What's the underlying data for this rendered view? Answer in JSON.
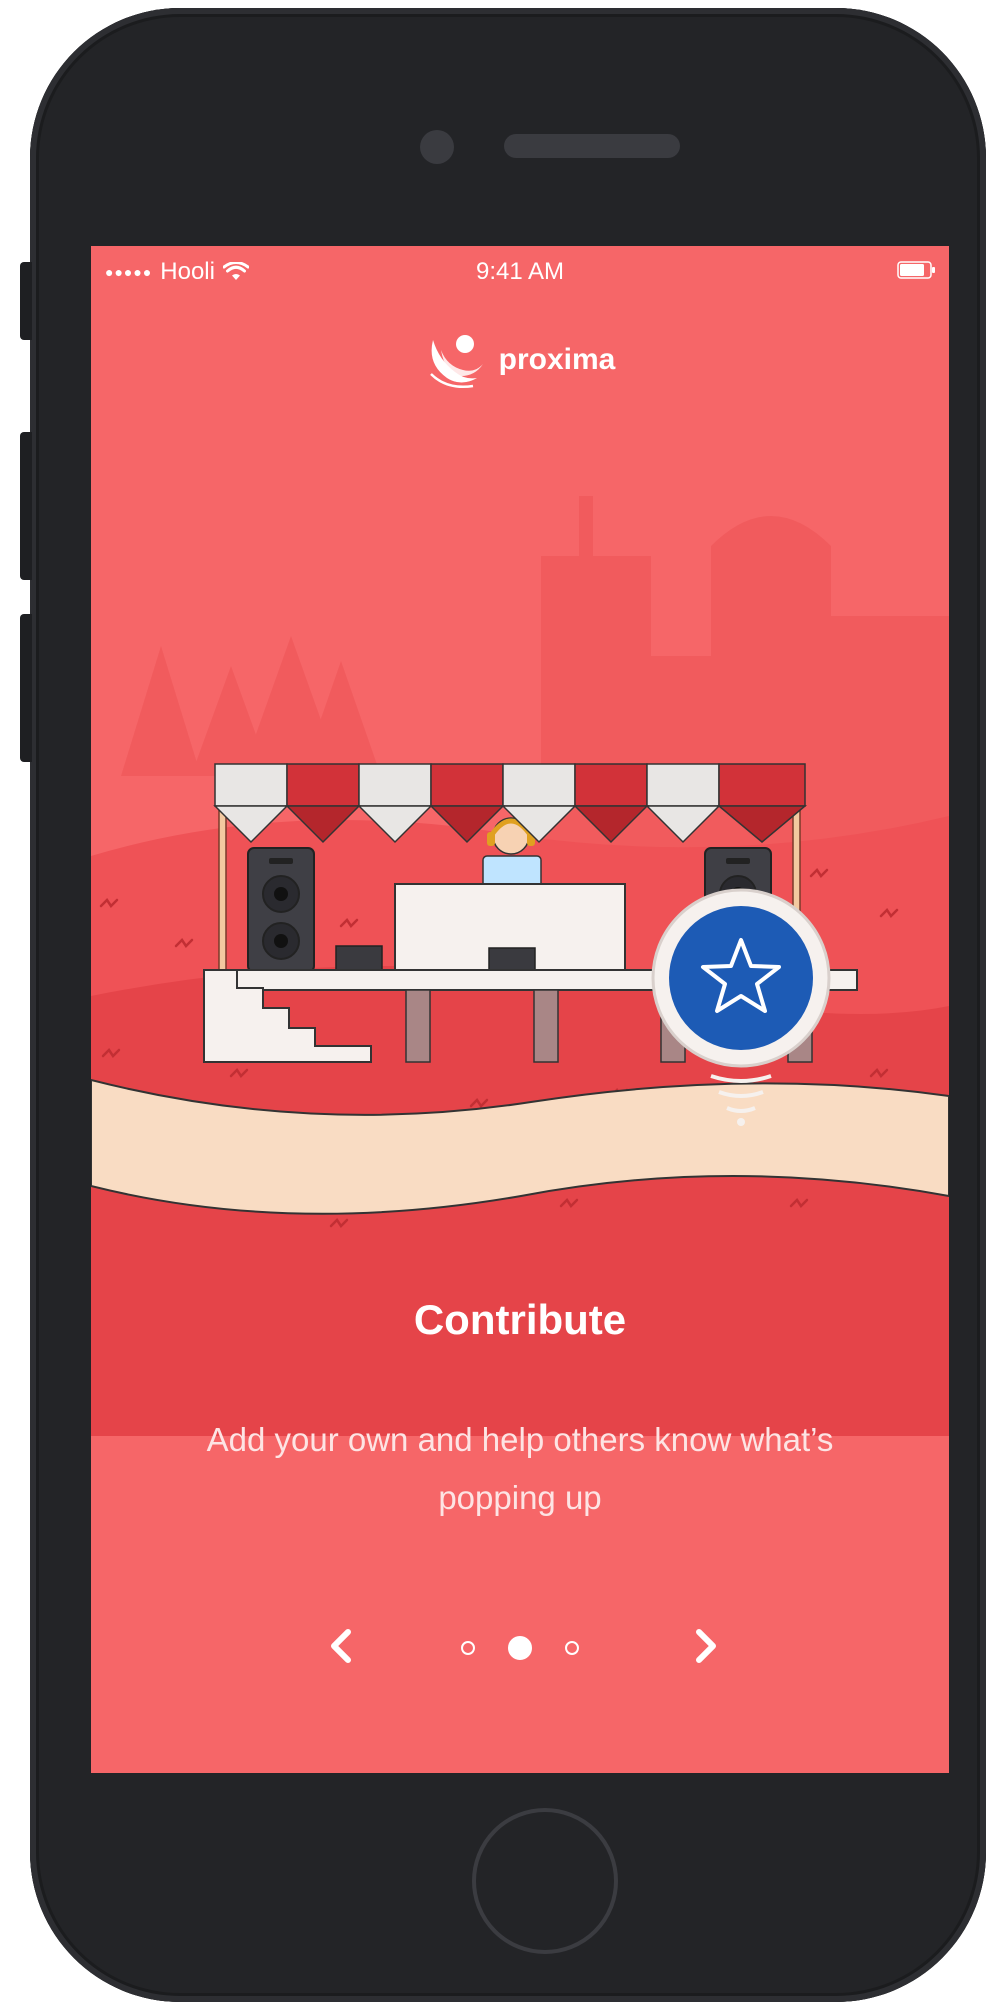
{
  "status_bar": {
    "signal": "●●●●●",
    "carrier": "Hooli",
    "time": "9:41 AM"
  },
  "brand": {
    "name": "proxima"
  },
  "onboarding": {
    "title": "Contribute",
    "description": "Add your own and help others know what’s popping up",
    "page_indicator": {
      "total": 3,
      "active_index": 1
    }
  },
  "icons": {
    "prev": "chevron-left-icon",
    "next": "chevron-right-icon",
    "star": "star-icon",
    "wifi": "wifi-icon",
    "battery": "battery-icon",
    "logo": "proxima-logo-icon"
  },
  "colors": {
    "screen_bg": "#f66668",
    "phone_body": "#232427",
    "pin_blue": "#1d5bb5",
    "awning_red": "#d23239",
    "sand": "#f9dcc3"
  }
}
